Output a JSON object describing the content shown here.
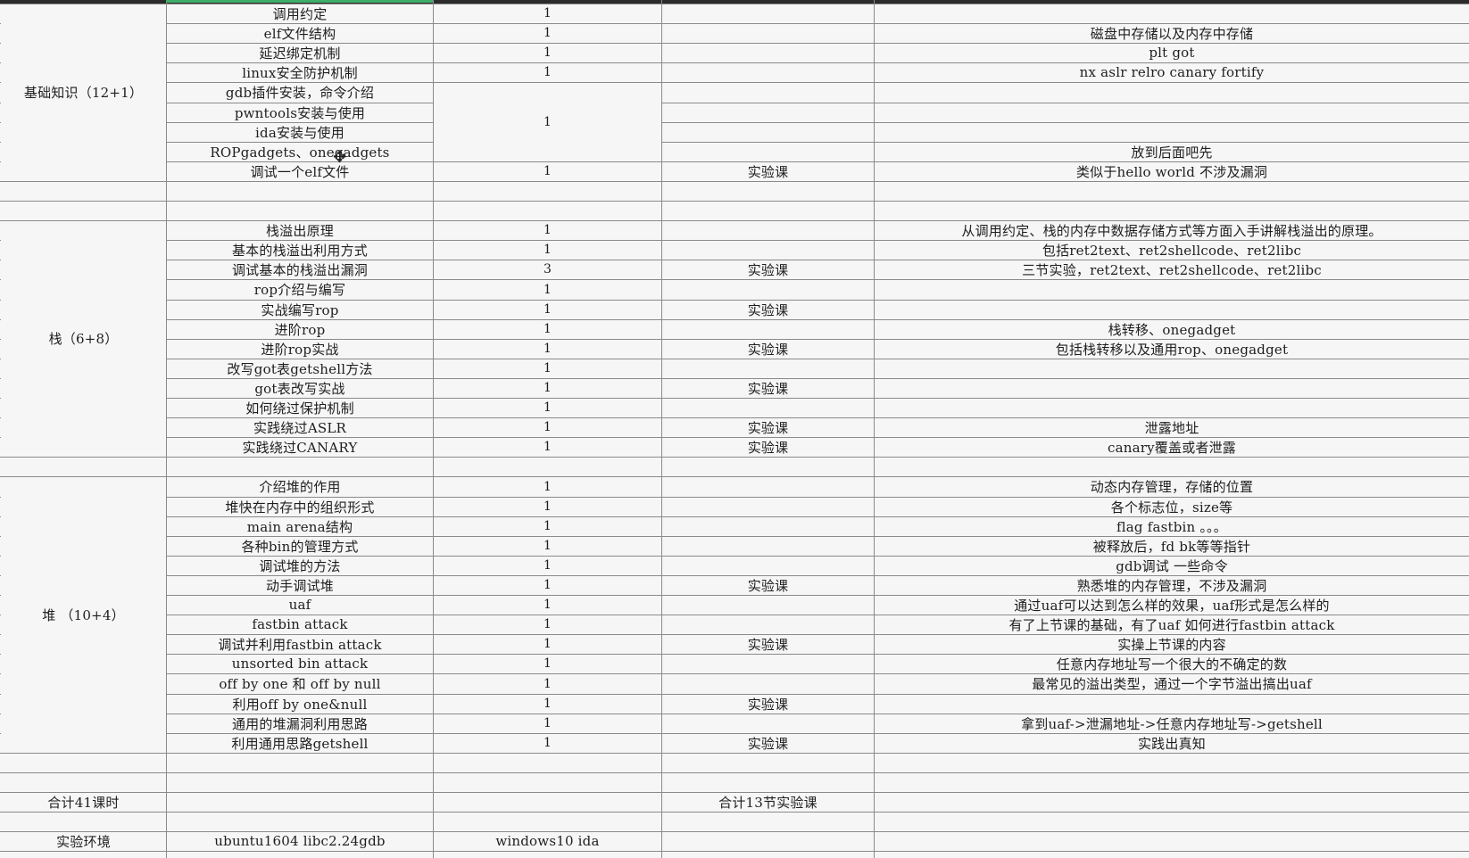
{
  "sections": [
    {
      "name": "基础知识（12+1）",
      "rows": [
        {
          "topic": "调用约定",
          "hours": "1",
          "type": "",
          "note": ""
        },
        {
          "topic": "elf文件结构",
          "hours": "1",
          "type": "",
          "note": "磁盘中存储以及内存中存储"
        },
        {
          "topic": "延迟绑定机制",
          "hours": "1",
          "type": "",
          "note": "plt got"
        },
        {
          "topic": "linux安全防护机制",
          "hours": "1",
          "type": "",
          "note": "nx aslr relro canary fortify"
        },
        {
          "topic": "gdb插件安装，命令介绍",
          "hours": "1",
          "type": "",
          "note": ""
        },
        {
          "topic": "pwntools安装与使用",
          "hours": "",
          "type": "",
          "note": ""
        },
        {
          "topic": "ida安装与使用",
          "hours": "",
          "type": "",
          "note": ""
        },
        {
          "topic": "ROPgadgets、onegadgets",
          "hours": "",
          "type": "",
          "note": "放到后面吧先"
        },
        {
          "topic": "调试一个elf文件",
          "hours": "1",
          "type": "实验课",
          "note": "类似于hello world 不涉及漏洞"
        }
      ]
    },
    {
      "name": "栈（6+8）",
      "rows": [
        {
          "topic": "栈溢出原理",
          "hours": "1",
          "type": "",
          "note": "从调用约定、栈的内存中数据存储方式等方面入手讲解栈溢出的原理。"
        },
        {
          "topic": "基本的栈溢出利用方式",
          "hours": "1",
          "type": "",
          "note": "包括ret2text、ret2shellcode、ret2libc"
        },
        {
          "topic": "调试基本的栈溢出漏洞",
          "hours": "3",
          "type": "实验课",
          "note": "三节实验，ret2text、ret2shellcode、ret2libc"
        },
        {
          "topic": "rop介绍与编写",
          "hours": "1",
          "type": "",
          "note": ""
        },
        {
          "topic": "实战编写rop",
          "hours": "1",
          "type": "实验课",
          "note": ""
        },
        {
          "topic": "进阶rop",
          "hours": "1",
          "type": "",
          "note": "栈转移、onegadget"
        },
        {
          "topic": "进阶rop实战",
          "hours": "1",
          "type": "实验课",
          "note": "包括栈转移以及通用rop、onegadget"
        },
        {
          "topic": "改写got表getshell方法",
          "hours": "1",
          "type": "",
          "note": ""
        },
        {
          "topic": "got表改写实战",
          "hours": "1",
          "type": "实验课",
          "note": ""
        },
        {
          "topic": "如何绕过保护机制",
          "hours": "1",
          "type": "",
          "note": ""
        },
        {
          "topic": "实践绕过ASLR",
          "hours": "1",
          "type": "实验课",
          "note": "泄露地址"
        },
        {
          "topic": "实践绕过CANARY",
          "hours": "1",
          "type": "实验课",
          "note": "canary覆盖或者泄露"
        }
      ]
    },
    {
      "name": "堆 （10+4）",
      "rows": [
        {
          "topic": "介绍堆的作用",
          "hours": "1",
          "type": "",
          "note": "动态内存管理，存储的位置"
        },
        {
          "topic": "堆快在内存中的组织形式",
          "hours": "1",
          "type": "",
          "note": "各个标志位，size等"
        },
        {
          "topic": "main arena结构",
          "hours": "1",
          "type": "",
          "note": "flag fastbin 。。。"
        },
        {
          "topic": "各种bin的管理方式",
          "hours": "1",
          "type": "",
          "note": "被释放后，fd bk等等指针"
        },
        {
          "topic": "调试堆的方法",
          "hours": "1",
          "type": "",
          "note": "gdb调试 一些命令"
        },
        {
          "topic": "动手调试堆",
          "hours": "1",
          "type": "实验课",
          "note": "熟悉堆的内存管理，不涉及漏洞"
        },
        {
          "topic": "uaf",
          "hours": "1",
          "type": "",
          "note": "通过uaf可以达到怎么样的效果，uaf形式是怎么样的"
        },
        {
          "topic": "fastbin attack",
          "hours": "1",
          "type": "",
          "note": "有了上节课的基础，有了uaf 如何进行fastbin attack"
        },
        {
          "topic": "调试并利用fastbin attack",
          "hours": "1",
          "type": "实验课",
          "note": "实操上节课的内容"
        },
        {
          "topic": "unsorted bin attack",
          "hours": "1",
          "type": "",
          "note": "任意内存地址写一个很大的不确定的数"
        },
        {
          "topic": "off by one 和 off by null",
          "hours": "1",
          "type": "",
          "note": "最常见的溢出类型，通过一个字节溢出搞出uaf"
        },
        {
          "topic": "利用off by one&null",
          "hours": "1",
          "type": "实验课",
          "note": ""
        },
        {
          "topic": "通用的堆漏洞利用思路",
          "hours": "1",
          "type": "",
          "note": "拿到uaf->泄漏地址->任意内存地址写->getshell"
        },
        {
          "topic": "利用通用思路getshell",
          "hours": "1",
          "type": "实验课",
          "note": "实践出真知"
        }
      ]
    }
  ],
  "summary": {
    "label": "合计41课时",
    "lab_total": "合计13节实验课"
  },
  "environment": {
    "label": "实验环境",
    "linux": "ubuntu1604 libc2.24gdb",
    "windows": "windows10 ida"
  },
  "colors": {
    "grid": "#8a8a8a",
    "background": "#f6f6f6",
    "active": "#3fae6a"
  }
}
